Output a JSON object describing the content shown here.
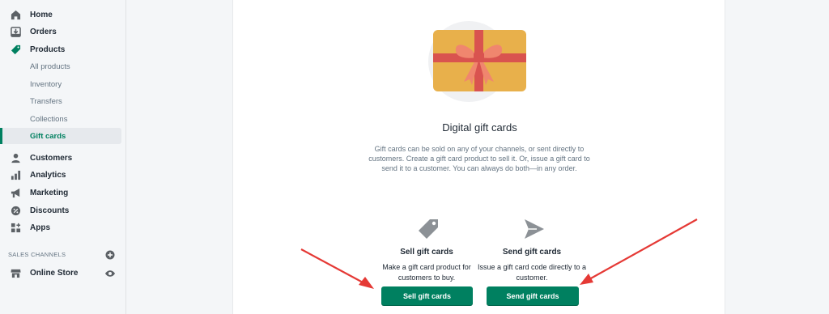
{
  "sidebar": {
    "items": [
      {
        "label": "Home",
        "icon": "home-icon"
      },
      {
        "label": "Orders",
        "icon": "orders-icon"
      },
      {
        "label": "Products",
        "icon": "tag-icon"
      },
      {
        "label": "Customers",
        "icon": "person-icon"
      },
      {
        "label": "Analytics",
        "icon": "bar-chart-icon"
      },
      {
        "label": "Marketing",
        "icon": "megaphone-icon"
      },
      {
        "label": "Discounts",
        "icon": "discount-icon"
      },
      {
        "label": "Apps",
        "icon": "apps-icon"
      }
    ],
    "product_sub_items": [
      "All products",
      "Inventory",
      "Transfers",
      "Collections",
      "Gift cards"
    ],
    "active_sub_item": "Gift cards",
    "sales_channels_label": "SALES CHANNELS",
    "online_store_label": "Online Store"
  },
  "main": {
    "title": "Digital gift cards",
    "description": "Gift cards can be sold on any of your channels, or sent directly to customers. Create a gift card product to sell it. Or, issue a gift card to send it to a customer. You can always do both—in any order.",
    "sell": {
      "title": "Sell gift cards",
      "description": "Make a gift card product for customers to buy.",
      "button": "Sell gift cards",
      "icon": "tag-icon"
    },
    "send": {
      "title": "Send gift cards",
      "description": "Issue a gift card code directly to a customer.",
      "button": "Send gift cards",
      "icon": "send-icon"
    }
  },
  "colors": {
    "primary": "#008060",
    "sidebar_bg": "#f4f6f8",
    "annotation_arrow": "#e53935",
    "card_gold": "#e8b04b",
    "ribbon": "#d9534f"
  }
}
